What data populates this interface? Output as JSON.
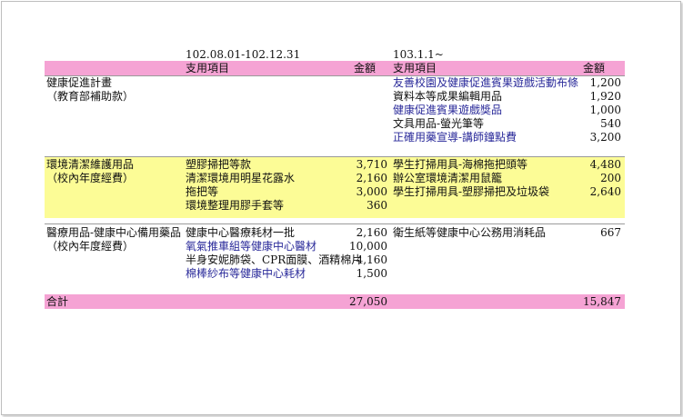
{
  "header": {
    "period_left": "102.08.01-102.12.31",
    "period_right": "103.1.1~",
    "col_item_left": "支用項目",
    "col_amount_left": "金額",
    "col_item_right": "支用項目",
    "col_amount_right": "金額"
  },
  "sections": [
    {
      "title": "健康促進計畫",
      "fund": "（教育部補助款）",
      "left": [],
      "right": [
        {
          "item": "友善校園及健康促進賓果遊戲活動布條",
          "amount": "1,200"
        },
        {
          "item": "資料本等成果編輯用品",
          "amount": "1,920"
        },
        {
          "item": "健康促進賓果遊戲獎品",
          "amount": "1,000"
        },
        {
          "item": "文具用品-螢光筆等",
          "amount": "540"
        },
        {
          "item": "正確用藥宣導-講師鐘點費",
          "amount": "3,200"
        }
      ]
    },
    {
      "title": "環境清潔維護用品",
      "fund": "（校內年度經費）",
      "left": [
        {
          "item": "塑膠掃把等款",
          "amount": "3,710"
        },
        {
          "item": "清潔環境用明星花露水",
          "amount": "2,160"
        },
        {
          "item": "拖把等",
          "amount": "3,000"
        },
        {
          "item": "環境整理用膠手套等",
          "amount": "360"
        }
      ],
      "right": [
        {
          "item": "學生打掃用具-海棉拖把頭等",
          "amount": "4,480"
        },
        {
          "item": "辦公室環境清潔用鼠籠",
          "amount": "200"
        },
        {
          "item": "學生打掃用具-塑膠掃把及垃圾袋",
          "amount": "2,640"
        }
      ]
    },
    {
      "title": "醫療用品-健康中心備用藥品",
      "fund": "（校內年度經費）",
      "left": [
        {
          "item": "健康中心醫療耗材一批",
          "amount": "2,160"
        },
        {
          "item": "氧氣推車組等健康中心醫材",
          "amount": "10,000"
        },
        {
          "item": "半身安妮肺袋、CPR面膜、酒精棉片",
          "amount": "4,160"
        },
        {
          "item": "棉棒紗布等健康中心耗材",
          "amount": "1,500"
        }
      ],
      "right": [
        {
          "item": "衛生紙等健康中心公務用消耗品",
          "amount": "667"
        }
      ]
    }
  ],
  "total": {
    "label": "合計",
    "left_amount": "27,050",
    "right_amount": "15,847"
  },
  "colors": {
    "header_band": "#f5a3d4",
    "highlight_band": "#fcfc96",
    "link_text": "#2a2a9a"
  }
}
